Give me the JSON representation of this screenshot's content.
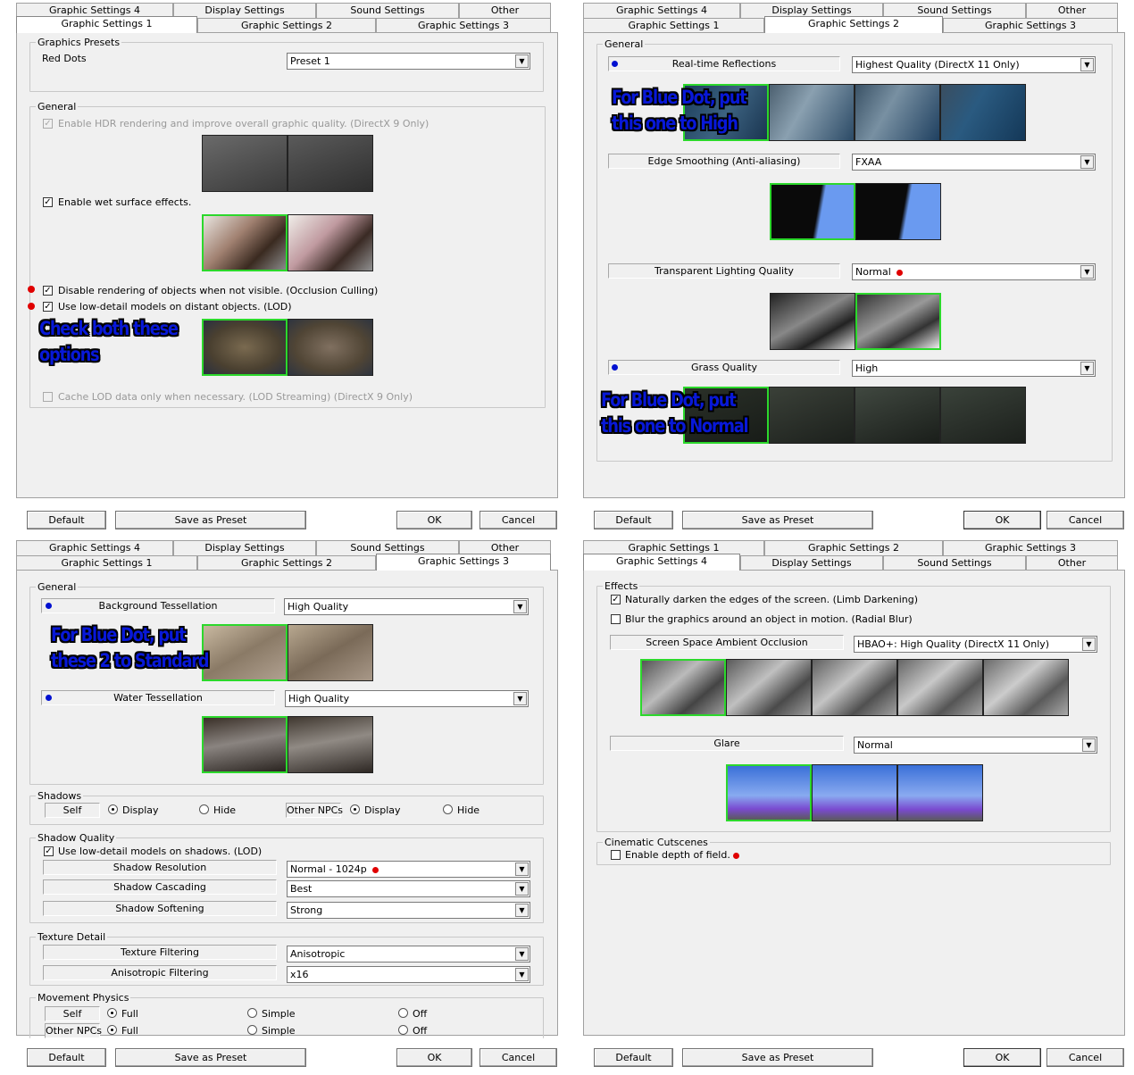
{
  "tabs_row_back": [
    "Graphic Settings 4",
    "Display Settings",
    "Sound Settings",
    "Other"
  ],
  "tabs_row_front": [
    "Graphic Settings 1",
    "Graphic Settings 2",
    "Graphic Settings 3"
  ],
  "tabs_row_back_p4": [
    "Graphic Settings 1",
    "Graphic Settings 2",
    "Graphic Settings 3"
  ],
  "tabs_row_front_p4": [
    "Graphic Settings 4",
    "Display Settings",
    "Sound Settings",
    "Other"
  ],
  "buttons": {
    "default": "Default",
    "save_preset": "Save as Preset",
    "ok": "OK",
    "cancel": "Cancel"
  },
  "p1": {
    "presets_title": "Graphics Presets",
    "red_dots": "Red Dots",
    "preset_value": "Preset 1",
    "general_title": "General",
    "hdr": "Enable HDR rendering and improve overall graphic quality. (DirectX 9 Only)",
    "wet": "Enable wet surface effects.",
    "occlusion": "Disable rendering of objects when not visible. (Occlusion Culling)",
    "lod": "Use low-detail models on distant objects. (LOD)",
    "lod_stream": "Cache LOD data only when necessary. (LOD Streaming) (DirectX 9 Only)",
    "note_line1": "Check both these",
    "note_line2": "options"
  },
  "p2": {
    "general_title": "General",
    "reflections_label": "Real-time Reflections",
    "reflections_value": "Highest Quality (DirectX 11 Only)",
    "note1_line1": "For Blue Dot, put",
    "note1_line2": "this one to High",
    "edge_label": "Edge Smoothing (Anti-aliasing)",
    "edge_value": "FXAA",
    "trans_label": "Transparent Lighting Quality",
    "trans_value": "Normal",
    "grass_label": "Grass Quality",
    "grass_value": "High",
    "note2_line1": "For Blue Dot, put",
    "note2_line2": "this one to Normal"
  },
  "p3": {
    "general_title": "General",
    "bg_tess_label": "Background Tessellation",
    "bg_tess_value": "High Quality",
    "note_line1": "For Blue Dot, put",
    "note_line2": "these 2 to Standard",
    "water_tess_label": "Water Tessellation",
    "water_tess_value": "High Quality",
    "shadows_title": "Shadows",
    "self": "Self",
    "display": "Display",
    "hide": "Hide",
    "other_npcs": "Other NPCs",
    "shadow_quality_title": "Shadow Quality",
    "shadow_lod": "Use low-detail models on shadows. (LOD)",
    "shadow_res_label": "Shadow Resolution",
    "shadow_res_value": "Normal - 1024p",
    "shadow_casc_label": "Shadow Cascading",
    "shadow_casc_value": "Best",
    "shadow_soft_label": "Shadow Softening",
    "shadow_soft_value": "Strong",
    "texture_title": "Texture Detail",
    "tex_filter_label": "Texture Filtering",
    "tex_filter_value": "Anisotropic",
    "aniso_label": "Anisotropic Filtering",
    "aniso_value": "x16",
    "movement_title": "Movement Physics",
    "full": "Full",
    "simple": "Simple",
    "off": "Off"
  },
  "p4": {
    "effects_title": "Effects",
    "limb": "Naturally darken the edges of the screen. (Limb Darkening)",
    "radial": "Blur the graphics around an object in motion. (Radial Blur)",
    "ssao_label": "Screen Space Ambient Occlusion",
    "ssao_value": "HBAO+: High Quality (DirectX 11 Only)",
    "glare_label": "Glare",
    "glare_value": "Normal",
    "cutscenes_title": "Cinematic Cutscenes",
    "dof": "Enable depth of field."
  },
  "colors": {
    "highlight": "#2cd82c",
    "note_text": "#0818d8",
    "red_dot": "#e00000",
    "blue_dot": "#0010d0"
  }
}
